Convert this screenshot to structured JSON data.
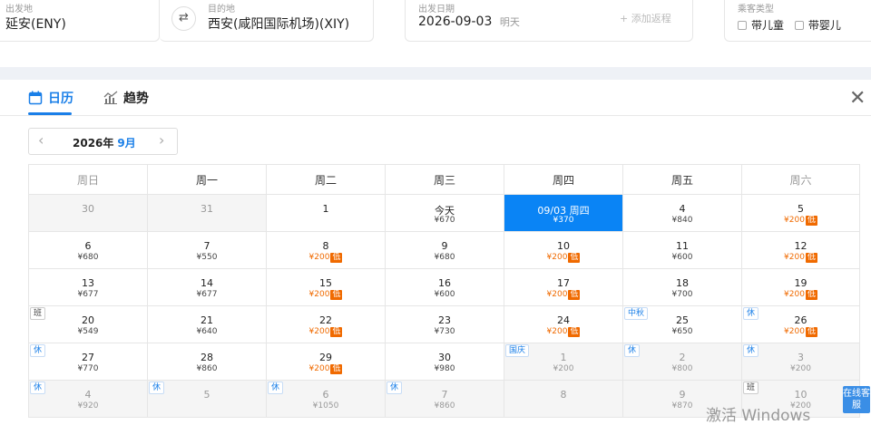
{
  "search": {
    "origin_label": "出发地",
    "origin_value": "延安(ENY)",
    "dest_label": "目的地",
    "dest_value": "西安(咸阳国际机场)(XIY)",
    "date_label": "出发日期",
    "date_value": "2026-09-03",
    "date_note": "明天",
    "add_return": "+ 添加返程",
    "passenger_label": "乘客类型",
    "child": "带儿童",
    "infant": "带婴儿"
  },
  "tabs": {
    "calendar": "日历",
    "trend": "趋势"
  },
  "month": {
    "year": "2026年",
    "month": "9月"
  },
  "weekdays": [
    "周日",
    "周一",
    "周二",
    "周三",
    "周四",
    "周五",
    "周六"
  ],
  "weeks": [
    [
      {
        "d": "30",
        "p": "",
        "dim": true
      },
      {
        "d": "31",
        "p": "",
        "dim": true
      },
      {
        "d": "1",
        "p": ""
      },
      {
        "d": "今天",
        "p": "¥670"
      },
      {
        "d": "09/03 周四",
        "p": "¥370",
        "sel": true
      },
      {
        "d": "4",
        "p": "¥840"
      },
      {
        "d": "5",
        "p": "¥200",
        "low": "低"
      }
    ],
    [
      {
        "d": "6",
        "p": "¥680"
      },
      {
        "d": "7",
        "p": "¥550"
      },
      {
        "d": "8",
        "p": "¥200",
        "low": "低"
      },
      {
        "d": "9",
        "p": "¥680"
      },
      {
        "d": "10",
        "p": "¥200",
        "low": "低"
      },
      {
        "d": "11",
        "p": "¥600"
      },
      {
        "d": "12",
        "p": "¥200",
        "low": "低"
      }
    ],
    [
      {
        "d": "13",
        "p": "¥677"
      },
      {
        "d": "14",
        "p": "¥677"
      },
      {
        "d": "15",
        "p": "¥200",
        "low": "低"
      },
      {
        "d": "16",
        "p": "¥600"
      },
      {
        "d": "17",
        "p": "¥200",
        "low": "低"
      },
      {
        "d": "18",
        "p": "¥700"
      },
      {
        "d": "19",
        "p": "¥200",
        "low": "低"
      }
    ],
    [
      {
        "d": "20",
        "p": "¥549",
        "tag": "班"
      },
      {
        "d": "21",
        "p": "¥640"
      },
      {
        "d": "22",
        "p": "¥200",
        "low": "低"
      },
      {
        "d": "23",
        "p": "¥730"
      },
      {
        "d": "24",
        "p": "¥200",
        "low": "低"
      },
      {
        "d": "25",
        "p": "¥650",
        "tag": "中秋",
        "tagblue": true
      },
      {
        "d": "26",
        "p": "¥200",
        "low": "低",
        "tag": "休",
        "tagblue": true
      }
    ],
    [
      {
        "d": "27",
        "p": "¥770",
        "tag": "休",
        "tagblue": true
      },
      {
        "d": "28",
        "p": "¥860"
      },
      {
        "d": "29",
        "p": "¥200",
        "low": "低"
      },
      {
        "d": "30",
        "p": "¥980"
      },
      {
        "d": "1",
        "p": "¥200",
        "dim": true,
        "tag": "国庆",
        "tagblue": true
      },
      {
        "d": "2",
        "p": "¥800",
        "dim": true,
        "tag": "休",
        "tagblue": true
      },
      {
        "d": "3",
        "p": "¥200",
        "dim": true,
        "tag": "休",
        "tagblue": true
      }
    ],
    [
      {
        "d": "4",
        "p": "¥920",
        "dim": true,
        "tag": "休",
        "tagblue": true
      },
      {
        "d": "5",
        "p": "",
        "dim": true,
        "tag": "休",
        "tagblue": true
      },
      {
        "d": "6",
        "p": "¥1050",
        "dim": true,
        "tag": "休",
        "tagblue": true
      },
      {
        "d": "7",
        "p": "¥860",
        "dim": true,
        "tag": "休",
        "tagblue": true
      },
      {
        "d": "8",
        "p": "",
        "dim": true
      },
      {
        "d": "9",
        "p": "¥870",
        "dim": true
      },
      {
        "d": "10",
        "p": "¥200",
        "dim": true,
        "tag": "班"
      }
    ]
  ],
  "widget": {
    "online": "在线客服",
    "watermark": "激活 Windows"
  }
}
